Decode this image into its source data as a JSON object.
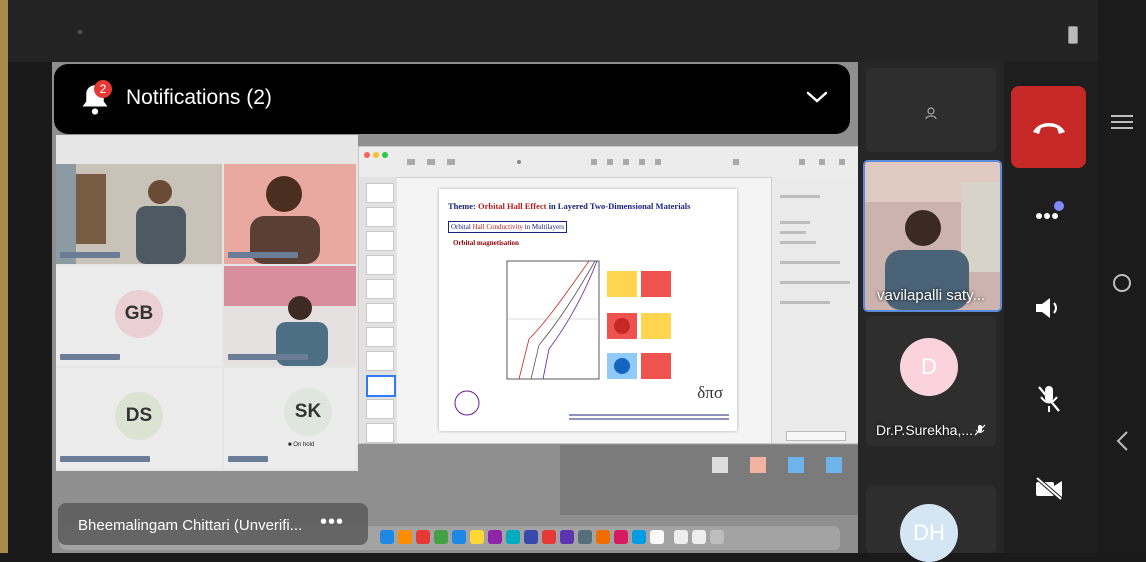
{
  "notification": {
    "title": "Notifications (2)",
    "badge_count": "2",
    "icon": "bell-icon",
    "collapse_icon": "chevron-down-icon"
  },
  "shared_screen": {
    "gallery_avatars": [
      {
        "initials": "GB",
        "color": "#ead0d5"
      },
      {
        "initials": "DS",
        "color": "#dce3d2"
      },
      {
        "initials": "SK",
        "color": "#dfe6dd"
      }
    ],
    "on_hold_label": "On hold",
    "slide": {
      "title_prefix": "Theme:",
      "title_highlight": "Orbital Hall Effect",
      "title_rest": "in Layered Two-Dimensional Materials",
      "subtitle_prefix": "Orbital",
      "subtitle_highlight": "Hall Conductivity",
      "subtitle_rest": "in Multilayers",
      "heading": "Orbital magnetisation",
      "logo_text": "δπσ"
    }
  },
  "active_speaker": {
    "name": "Bheemalingam Chittari (Unverifi...",
    "more_icon": "more-dots-icon"
  },
  "participants": {
    "self": {
      "icon": "person-icon"
    },
    "pinned": {
      "name": "vavilapalli saty..."
    },
    "p1": {
      "initials": "D",
      "name": "Dr.P.Surekha,...",
      "mic_icon": "mic-muted-icon",
      "color": "#fbd3dc"
    },
    "p2": {
      "initials": "DH",
      "color": "#d4e6f4"
    }
  },
  "controls": {
    "leave": "end-call-icon",
    "more": "more-horizontal-icon",
    "speaker": "speaker-icon",
    "mic": "mic-off-icon",
    "camera": "camera-off-icon"
  },
  "colors": {
    "end_call": "#c62828",
    "highlight_border": "#5b8cd9",
    "badge": "#e53935"
  }
}
